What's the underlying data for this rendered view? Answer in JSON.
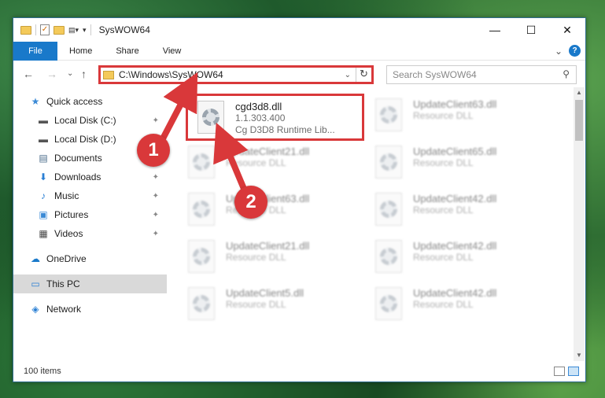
{
  "window": {
    "title": "SysWOW64",
    "minimize": "—",
    "maximize": "☐",
    "close": "✕"
  },
  "ribbon": {
    "tabs": [
      "File",
      "Home",
      "Share",
      "View"
    ],
    "collapse": "⌄",
    "help": "?"
  },
  "nav": {
    "back": "←",
    "forward": "→",
    "recent": "⌄",
    "up": "↑"
  },
  "address": {
    "path": "C:\\Windows\\SysWOW64",
    "dropdown": "⌄",
    "refresh": "↻"
  },
  "search": {
    "placeholder": "Search SysWOW64",
    "icon": "⚲"
  },
  "sidebar": {
    "items": [
      {
        "label": "Quick access",
        "icon": "star-icon",
        "glyph": "★",
        "color": "#3b8ad6",
        "pinned": false
      },
      {
        "label": "Local Disk (C:)",
        "icon": "drive-icon",
        "glyph": "▬",
        "color": "#555555",
        "pinned": true
      },
      {
        "label": "Local Disk (D:)",
        "icon": "drive-icon",
        "glyph": "▬",
        "color": "#555555",
        "pinned": true
      },
      {
        "label": "Documents",
        "icon": "document-icon",
        "glyph": "▤",
        "color": "#4a6c8a",
        "pinned": true
      },
      {
        "label": "Downloads",
        "icon": "download-icon",
        "glyph": "⬇",
        "color": "#2a7fd4",
        "pinned": true
      },
      {
        "label": "Music",
        "icon": "music-icon",
        "glyph": "♪",
        "color": "#2a7fd4",
        "pinned": true
      },
      {
        "label": "Pictures",
        "icon": "pictures-icon",
        "glyph": "▣",
        "color": "#3b8ad6",
        "pinned": true
      },
      {
        "label": "Videos",
        "icon": "video-icon",
        "glyph": "▦",
        "color": "#444444",
        "pinned": true
      },
      {
        "label": "OneDrive",
        "icon": "cloud-icon",
        "glyph": "☁",
        "color": "#1979ca",
        "pinned": false
      },
      {
        "label": "This PC",
        "icon": "computer-icon",
        "glyph": "▭",
        "color": "#2a7fd4",
        "pinned": false,
        "selected": true
      },
      {
        "label": "Network",
        "icon": "network-icon",
        "glyph": "◈",
        "color": "#2a7fd4",
        "pinned": false
      }
    ],
    "pin_glyph": "📌"
  },
  "files": [
    {
      "name": "cgd3d8.dll",
      "line2": "1.1.303.400",
      "line3": "Cg D3D8 Runtime Lib...",
      "highlighted": true
    },
    {
      "name": "UpdateClient63.dll",
      "line2": "Resource DLL",
      "line3": ""
    },
    {
      "name": "UpdateClient21.dll",
      "line2": "Resource DLL",
      "line3": ""
    },
    {
      "name": "UpdateClient65.dll",
      "line2": "Resource DLL",
      "line3": ""
    },
    {
      "name": "UpdateClient63.dll",
      "line2": "Resource DLL",
      "line3": ""
    },
    {
      "name": "UpdateClient42.dll",
      "line2": "Resource DLL",
      "line3": ""
    },
    {
      "name": "UpdateClient21.dll",
      "line2": "Resource DLL",
      "line3": ""
    },
    {
      "name": "UpdateClient42.dll",
      "line2": "Resource DLL",
      "line3": ""
    },
    {
      "name": "UpdateClient5.dll",
      "line2": "Resource DLL",
      "line3": ""
    },
    {
      "name": "UpdateClient42.dll",
      "line2": "Resource DLL",
      "line3": ""
    }
  ],
  "status": {
    "count": "100 items"
  },
  "annotations": [
    {
      "label": "1",
      "color": "#d9383a"
    },
    {
      "label": "2",
      "color": "#d9383a"
    }
  ]
}
